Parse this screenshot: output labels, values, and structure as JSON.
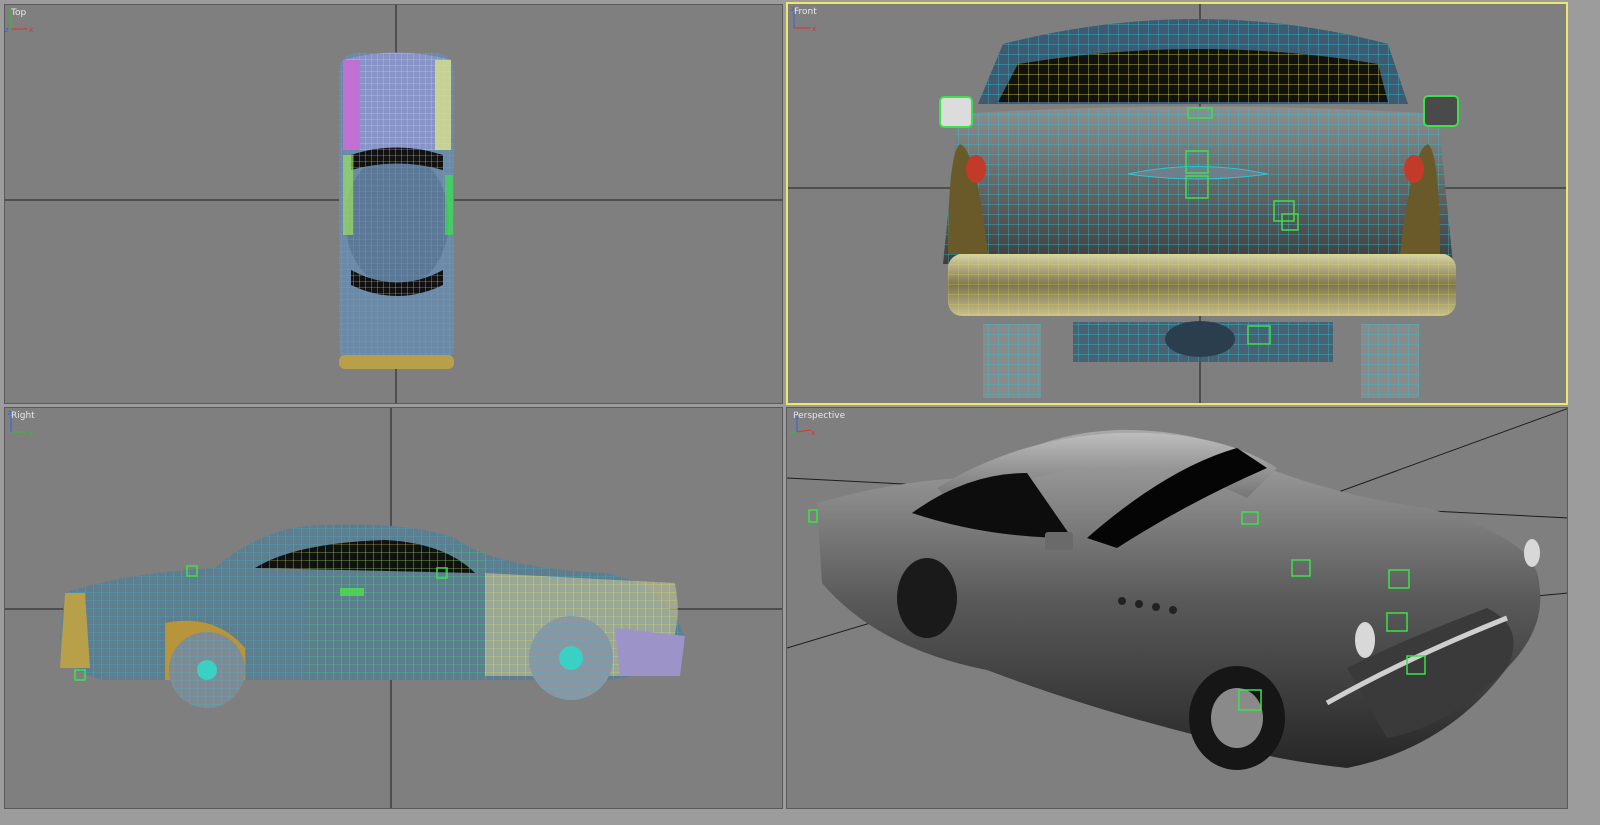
{
  "viewports": {
    "top": {
      "label": "Top"
    },
    "front": {
      "label": "Front"
    },
    "right": {
      "label": "Right"
    },
    "persp": {
      "label": "Perspective"
    }
  },
  "axis_labels": {
    "x": "x",
    "y": "y",
    "z": "z"
  },
  "colors": {
    "viewport_bg": "#7f7f7f",
    "active_border": "#ece86a",
    "wire_cyan": "#2ac6d8",
    "wire_yellow": "#e6e64a",
    "wire_green": "#3be24a",
    "wire_pink": "#d86be0"
  }
}
